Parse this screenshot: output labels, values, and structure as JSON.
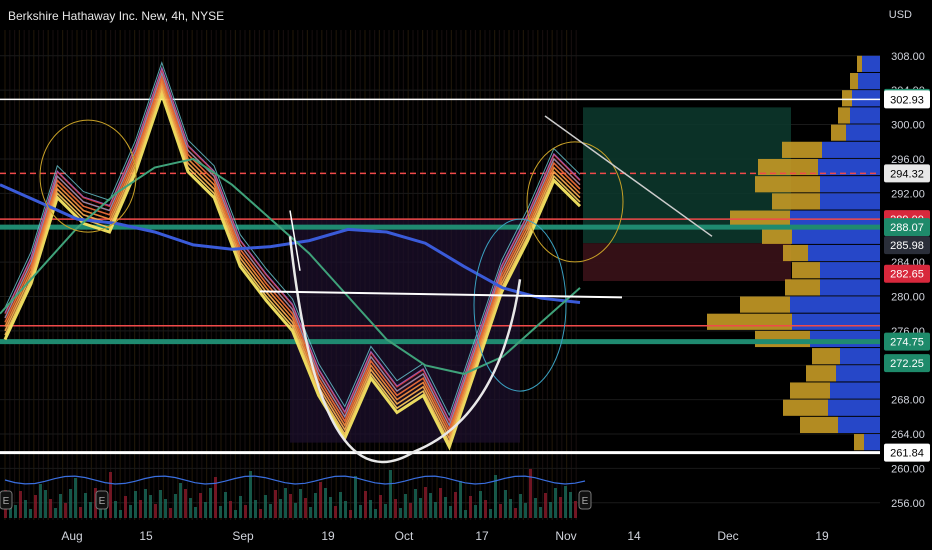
{
  "header": {
    "symbol_title": "Berkshire Hathaway Inc. New, 4h, NYSE",
    "currency": "USD"
  },
  "colors": {
    "background": "#000000",
    "ma_blue": "#3a5bd9",
    "ma_green": "#3fa27a",
    "yellow_ribbon": "#f5e663",
    "orange_ribbon": "#f08a3c",
    "red_line": "#f04a4a",
    "teal_line": "#1f8a70",
    "white_line": "#ffffff",
    "vp_blue": "#2647c8",
    "vp_gold": "#c59a26",
    "long_zone": "#0d3a2e",
    "short_zone": "#3a1218"
  },
  "chart_data": {
    "type": "line",
    "title": "Berkshire Hathaway Inc. New, 4h, NYSE",
    "interval": "4h",
    "ylabel": "USD",
    "ylim": [
      254,
      311
    ],
    "y_ticks": [
      256,
      260,
      264,
      268,
      272,
      276,
      280,
      284,
      288,
      292,
      296,
      300,
      304,
      308
    ],
    "y_tick_labels": [
      "256.00",
      "260.00",
      "264.00",
      "268.00",
      "272.00",
      "276.00",
      "280.00",
      "284.00",
      "288.00",
      "292.00",
      "296.00",
      "300.00",
      "304.00",
      "308.00"
    ],
    "x_tick_labels": [
      "Aug",
      "15",
      "Sep",
      "19",
      "Oct",
      "17",
      "Nov",
      "14",
      "Dec",
      "19"
    ],
    "series": [
      {
        "values": [
          276.5,
          283,
          293,
          290,
          289,
          296,
          305,
          296,
          293,
          285,
          281,
          277.5,
          270,
          265,
          272,
          268,
          270,
          264,
          273,
          282,
          288,
          295,
          292
        ]
      }
    ],
    "moving_average_slow": [
      293,
      291,
      289,
      288.5,
      287.5,
      286,
      285.5,
      285.8,
      286.5,
      287.8,
      287.5,
      286.2,
      283.5,
      281,
      279.8,
      279.3
    ],
    "horizontal_levels": [
      {
        "price": 302.93,
        "label": "302.93",
        "color": "#ffffff"
      },
      {
        "price": 294.32,
        "label": "294.32",
        "color": "#f04a4a"
      },
      {
        "price": 289.0,
        "label": "289.00",
        "color": "#f04a4a"
      },
      {
        "price": 288.07,
        "label": "288.07",
        "color": "#1f8a70"
      },
      {
        "price": 276.6,
        "label": "",
        "color": "#f04a4a"
      },
      {
        "price": 274.75,
        "label": "274.75",
        "color": "#1f8a70"
      },
      {
        "price": 261.84,
        "label": "261.84",
        "color": "#ffffff"
      }
    ],
    "price_tags": [
      {
        "label": "303.10",
        "price": 303.1,
        "color": "#1e8a6a"
      },
      {
        "label": "302.93",
        "price": 302.93,
        "color": "#ffffff"
      },
      {
        "label": "294.32",
        "price": 294.32,
        "color": "#e8e8e8"
      },
      {
        "label": "289.00",
        "price": 289.0,
        "color": "#d8283c"
      },
      {
        "label": "288.07",
        "price": 288.07,
        "color": "#1e8a6a"
      },
      {
        "label": "285.98",
        "price": 285.98,
        "color": "#2a2e39"
      },
      {
        "label": "282.65",
        "price": 282.65,
        "color": "#d8283c"
      },
      {
        "label": "274.75",
        "price": 274.75,
        "color": "#1e8a6a"
      },
      {
        "label": "272.25",
        "price": 272.25,
        "color": "#1e8a6a"
      },
      {
        "label": "261.84",
        "price": 261.84,
        "color": "#ffffff"
      }
    ],
    "volume_profile": [
      {
        "price": 307,
        "buy": 5,
        "sell": 18
      },
      {
        "price": 305,
        "buy": 8,
        "sell": 22
      },
      {
        "price": 303,
        "buy": 10,
        "sell": 28
      },
      {
        "price": 301,
        "buy": 12,
        "sell": 30
      },
      {
        "price": 299,
        "buy": 15,
        "sell": 34
      },
      {
        "price": 297,
        "buy": 40,
        "sell": 58
      },
      {
        "price": 295,
        "buy": 60,
        "sell": 62
      },
      {
        "price": 293,
        "buy": 65,
        "sell": 60
      },
      {
        "price": 291,
        "buy": 48,
        "sell": 60
      },
      {
        "price": 289,
        "buy": 60,
        "sell": 90
      },
      {
        "price": 287,
        "buy": 30,
        "sell": 88
      },
      {
        "price": 285,
        "buy": 25,
        "sell": 72
      },
      {
        "price": 283,
        "buy": 28,
        "sell": 60
      },
      {
        "price": 281,
        "buy": 35,
        "sell": 60
      },
      {
        "price": 279,
        "buy": 50,
        "sell": 90
      },
      {
        "price": 277,
        "buy": 85,
        "sell": 88
      },
      {
        "price": 275,
        "buy": 55,
        "sell": 70
      },
      {
        "price": 273,
        "buy": 28,
        "sell": 40
      },
      {
        "price": 271,
        "buy": 30,
        "sell": 44
      },
      {
        "price": 269,
        "buy": 40,
        "sell": 50
      },
      {
        "price": 267,
        "buy": 45,
        "sell": 52
      },
      {
        "price": 265,
        "buy": 38,
        "sell": 42
      },
      {
        "price": 263,
        "buy": 10,
        "sell": 16
      }
    ],
    "events_label": "E"
  }
}
